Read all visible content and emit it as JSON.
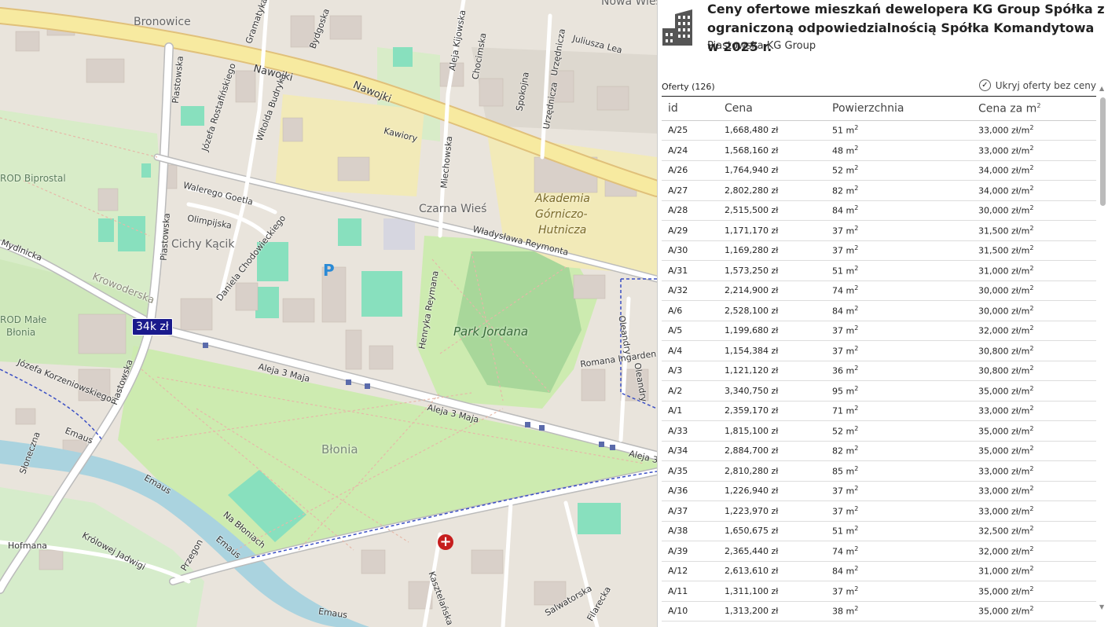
{
  "map": {
    "labels": {
      "bronowice": "Bronowice",
      "nawojki1": "Nawojki",
      "nawojki2": "Nawojki",
      "bydgoska": "Bydgoska",
      "gramatyka": "Gramatyka",
      "piastowska1": "Piastowska",
      "piastowska2": "Piastowska",
      "piastowska3": "Piastowska",
      "rostafinskiego": "Józefa Rostafińskiego",
      "budryka": "Witolda Budryka",
      "kawiory": "Kawiory",
      "aleja_kijowska": "Aleja Kijowska",
      "chocimska": "Chocimska",
      "spokojna": "Spokojna",
      "urzednicza1": "Urzędnicza",
      "urzednicza2": "Urzędnicza",
      "juliusza_lea": "Juliusza Lea",
      "nowa_wies": "Nowa Wieś",
      "rod_biprostal": "ROD Biprostal",
      "walerego": "Walerego Goetla",
      "olimpijska": "Olimpijska",
      "cichy_kacik": "Cichy Kącik",
      "chodowieckiego": "Daniela Chodowieckiego",
      "krowoderska": "Krowoderska",
      "mydlnicka": "Mydlnicka",
      "rod_male_blonia_1": "ROD Małe",
      "rod_male_blonia_2": "Błonia",
      "korzeniowskiego": "Józefa Korzeniowskiego",
      "czarna_wies": "Czarna Wieś",
      "miechowska": "Miechowska",
      "reymonta1": "Władysława Reymonta",
      "henryka_reymana": "Henryka Reymana",
      "park_jordana": "Park Jordana",
      "akademia_1": "Akademia",
      "akademia_2": "Górniczo-",
      "akademia_3": "Hutnicza",
      "oleandry1": "Oleandry",
      "oleandry2": "Oleandry",
      "ingardena": "Romana Ingardena",
      "aleja3maja1": "Aleja 3 Maja",
      "aleja3maja2": "Aleja 3 Maja",
      "aleja3maja3": "Aleja 3",
      "blonia": "Błonia",
      "emaus1": "Emaus",
      "emaus2": "Emaus",
      "emaus3": "Emaus",
      "emaus4": "Emaus",
      "sloneczna": "Słoneczna",
      "na_bloniach": "Na Błoniach",
      "krolowej_jadwigi": "Królowej Jadwigi",
      "hofmana": "Hofmana",
      "przegon": "Przegon",
      "kasztelanska": "Kasztelańska",
      "salwatorska": "Salwatorska",
      "filarecka": "Filarecka"
    },
    "price_marker": "34k zł",
    "parking": "P",
    "hospital": "+"
  },
  "panel": {
    "title": "Ceny ofertowe mieszkań dewelopera KG Group Spółka z ograniczoną odpowiedzialnością Spółka Komandytowa w 2025 r.",
    "subtitle": "Piastowska KG Group",
    "offers_label": "Oferty (126)",
    "hide_label": "Ukryj oferty bez ceny",
    "hide_checked": true,
    "columns": {
      "id": "id",
      "price": "Cena",
      "area": "Powierzchnia",
      "ppm": "Cena za m"
    },
    "area_unit": "m",
    "ppm_unit": "zł/m",
    "rows": [
      {
        "id": "A/25",
        "price": "1,668,480 zł",
        "area": "51",
        "ppm": "33,000"
      },
      {
        "id": "A/24",
        "price": "1,568,160 zł",
        "area": "48",
        "ppm": "33,000"
      },
      {
        "id": "A/26",
        "price": "1,764,940 zł",
        "area": "52",
        "ppm": "34,000"
      },
      {
        "id": "A/27",
        "price": "2,802,280 zł",
        "area": "82",
        "ppm": "34,000"
      },
      {
        "id": "A/28",
        "price": "2,515,500 zł",
        "area": "84",
        "ppm": "30,000"
      },
      {
        "id": "A/29",
        "price": "1,171,170 zł",
        "area": "37",
        "ppm": "31,500"
      },
      {
        "id": "A/30",
        "price": "1,169,280 zł",
        "area": "37",
        "ppm": "31,500"
      },
      {
        "id": "A/31",
        "price": "1,573,250 zł",
        "area": "51",
        "ppm": "31,000"
      },
      {
        "id": "A/32",
        "price": "2,214,900 zł",
        "area": "74",
        "ppm": "30,000"
      },
      {
        "id": "A/6",
        "price": "2,528,100 zł",
        "area": "84",
        "ppm": "30,000"
      },
      {
        "id": "A/5",
        "price": "1,199,680 zł",
        "area": "37",
        "ppm": "32,000"
      },
      {
        "id": "A/4",
        "price": "1,154,384 zł",
        "area": "37",
        "ppm": "30,800"
      },
      {
        "id": "A/3",
        "price": "1,121,120 zł",
        "area": "36",
        "ppm": "30,800"
      },
      {
        "id": "A/2",
        "price": "3,340,750 zł",
        "area": "95",
        "ppm": "35,000"
      },
      {
        "id": "A/1",
        "price": "2,359,170 zł",
        "area": "71",
        "ppm": "33,000"
      },
      {
        "id": "A/33",
        "price": "1,815,100 zł",
        "area": "52",
        "ppm": "35,000"
      },
      {
        "id": "A/34",
        "price": "2,884,700 zł",
        "area": "82",
        "ppm": "35,000"
      },
      {
        "id": "A/35",
        "price": "2,810,280 zł",
        "area": "85",
        "ppm": "33,000"
      },
      {
        "id": "A/36",
        "price": "1,226,940 zł",
        "area": "37",
        "ppm": "33,000"
      },
      {
        "id": "A/37",
        "price": "1,223,970 zł",
        "area": "37",
        "ppm": "33,000"
      },
      {
        "id": "A/38",
        "price": "1,650,675 zł",
        "area": "51",
        "ppm": "32,500"
      },
      {
        "id": "A/39",
        "price": "2,365,440 zł",
        "area": "74",
        "ppm": "32,000"
      },
      {
        "id": "A/12",
        "price": "2,613,610 zł",
        "area": "84",
        "ppm": "31,000"
      },
      {
        "id": "A/11",
        "price": "1,311,100 zł",
        "area": "37",
        "ppm": "35,000"
      },
      {
        "id": "A/10",
        "price": "1,313,200 zł",
        "area": "38",
        "ppm": "35,000"
      }
    ]
  },
  "colors": {
    "map_bg": "#f2efe9",
    "park": "#cdebb0",
    "sports": "#88e0be",
    "primary_road": "#fcd6a4",
    "secondary_road": "#f7fabf",
    "river": "#aad3df",
    "price_marker_bg": "#1a1a8c"
  }
}
